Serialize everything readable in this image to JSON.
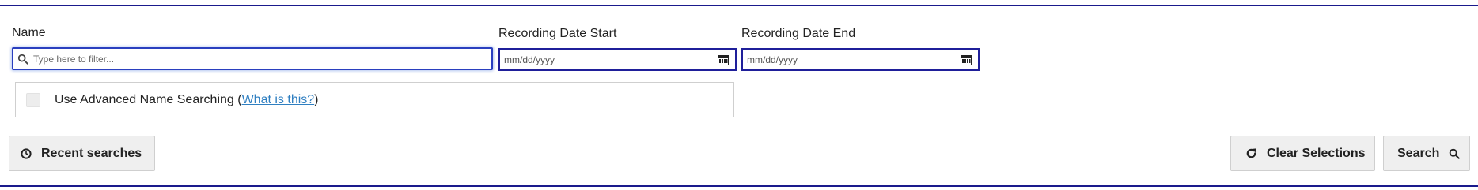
{
  "filters": {
    "name": {
      "label": "Name",
      "placeholder": "Type here to filter...",
      "icon": "search-icon"
    },
    "recording_date_start": {
      "label": "Recording Date Start",
      "placeholder": "mm/dd/yyyy",
      "icon": "calendar-icon"
    },
    "recording_date_end": {
      "label": "Recording Date End",
      "placeholder": "mm/dd/yyyy",
      "icon": "calendar-icon"
    }
  },
  "advanced": {
    "checked": false,
    "prefix": "Use Advanced Name Searching (",
    "link_text": "What is this?",
    "suffix": ")"
  },
  "actions": {
    "recent_searches": {
      "label": "Recent searches",
      "icon": "clock-icon"
    },
    "clear_selections": {
      "label": "Clear Selections",
      "icon": "refresh-icon"
    },
    "search": {
      "label": "Search",
      "icon": "search-icon"
    }
  },
  "colors": {
    "rule": "#1a1a8c",
    "input_border": "#2a3fbf",
    "link": "#2f7fc1",
    "button_bg": "#efefef"
  }
}
